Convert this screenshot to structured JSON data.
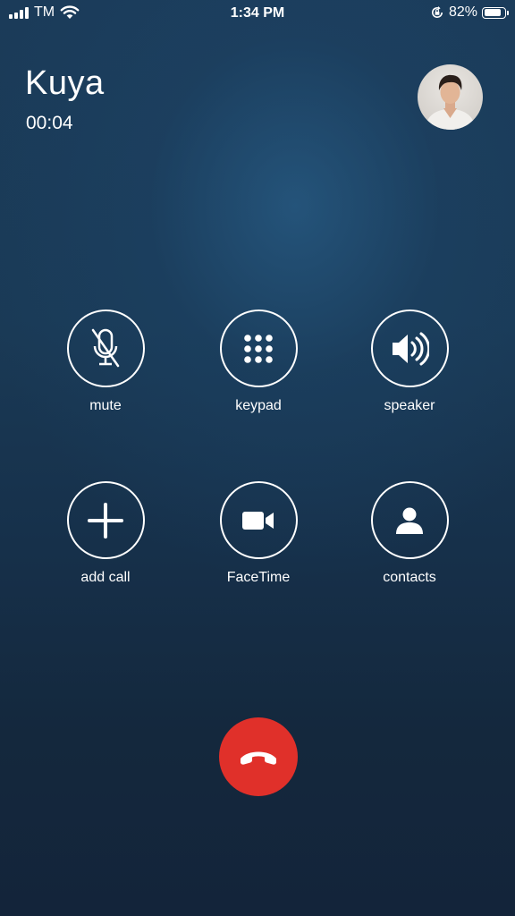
{
  "status_bar": {
    "carrier": "TM",
    "time": "1:34 PM",
    "battery_percent": "82%",
    "battery_level": 0.82,
    "icons": [
      "signal-icon",
      "wifi-icon",
      "rotation-lock-icon",
      "battery-icon"
    ]
  },
  "call": {
    "contact_name": "Kuya",
    "duration": "00:04"
  },
  "controls": {
    "mute": "mute",
    "keypad": "keypad",
    "speaker": "speaker",
    "add_call": "add call",
    "facetime": "FaceTime",
    "contacts": "contacts"
  },
  "colors": {
    "background_top": "#1b3b59",
    "background_bottom": "#13243a",
    "end_call": "#e0302a",
    "foreground": "#ffffff"
  }
}
